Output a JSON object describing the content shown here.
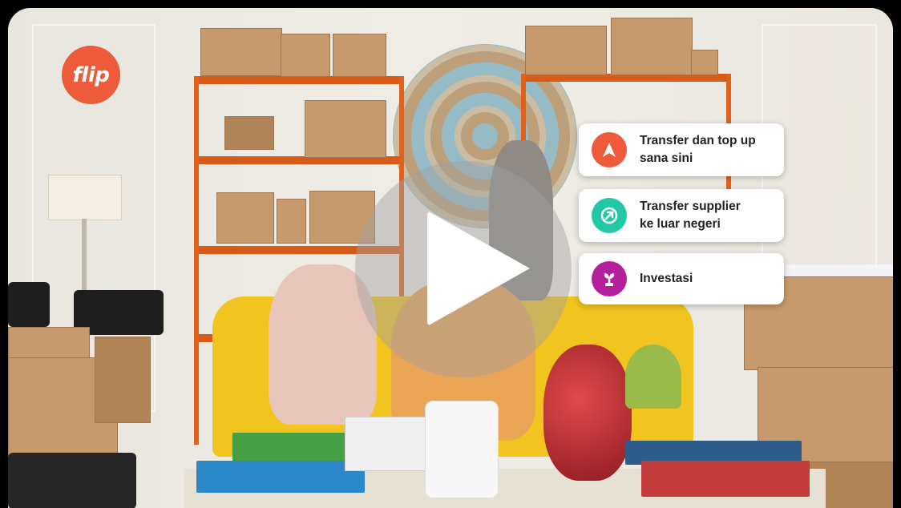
{
  "logo": {
    "text": "flip",
    "color": "#ed5b3b"
  },
  "player": {
    "play_icon": "play-icon"
  },
  "features": [
    {
      "icon": "paper-plane-icon",
      "color": "#ef5a3a",
      "line1": "Transfer dan top up",
      "line2": "sana sini"
    },
    {
      "icon": "globe-arrow-icon",
      "color": "#22c7a4",
      "line1": "Transfer supplier",
      "line2": "ke luar negeri"
    },
    {
      "icon": "plant-icon",
      "color": "#b4209c",
      "line1": "Investasi",
      "line2": ""
    }
  ]
}
